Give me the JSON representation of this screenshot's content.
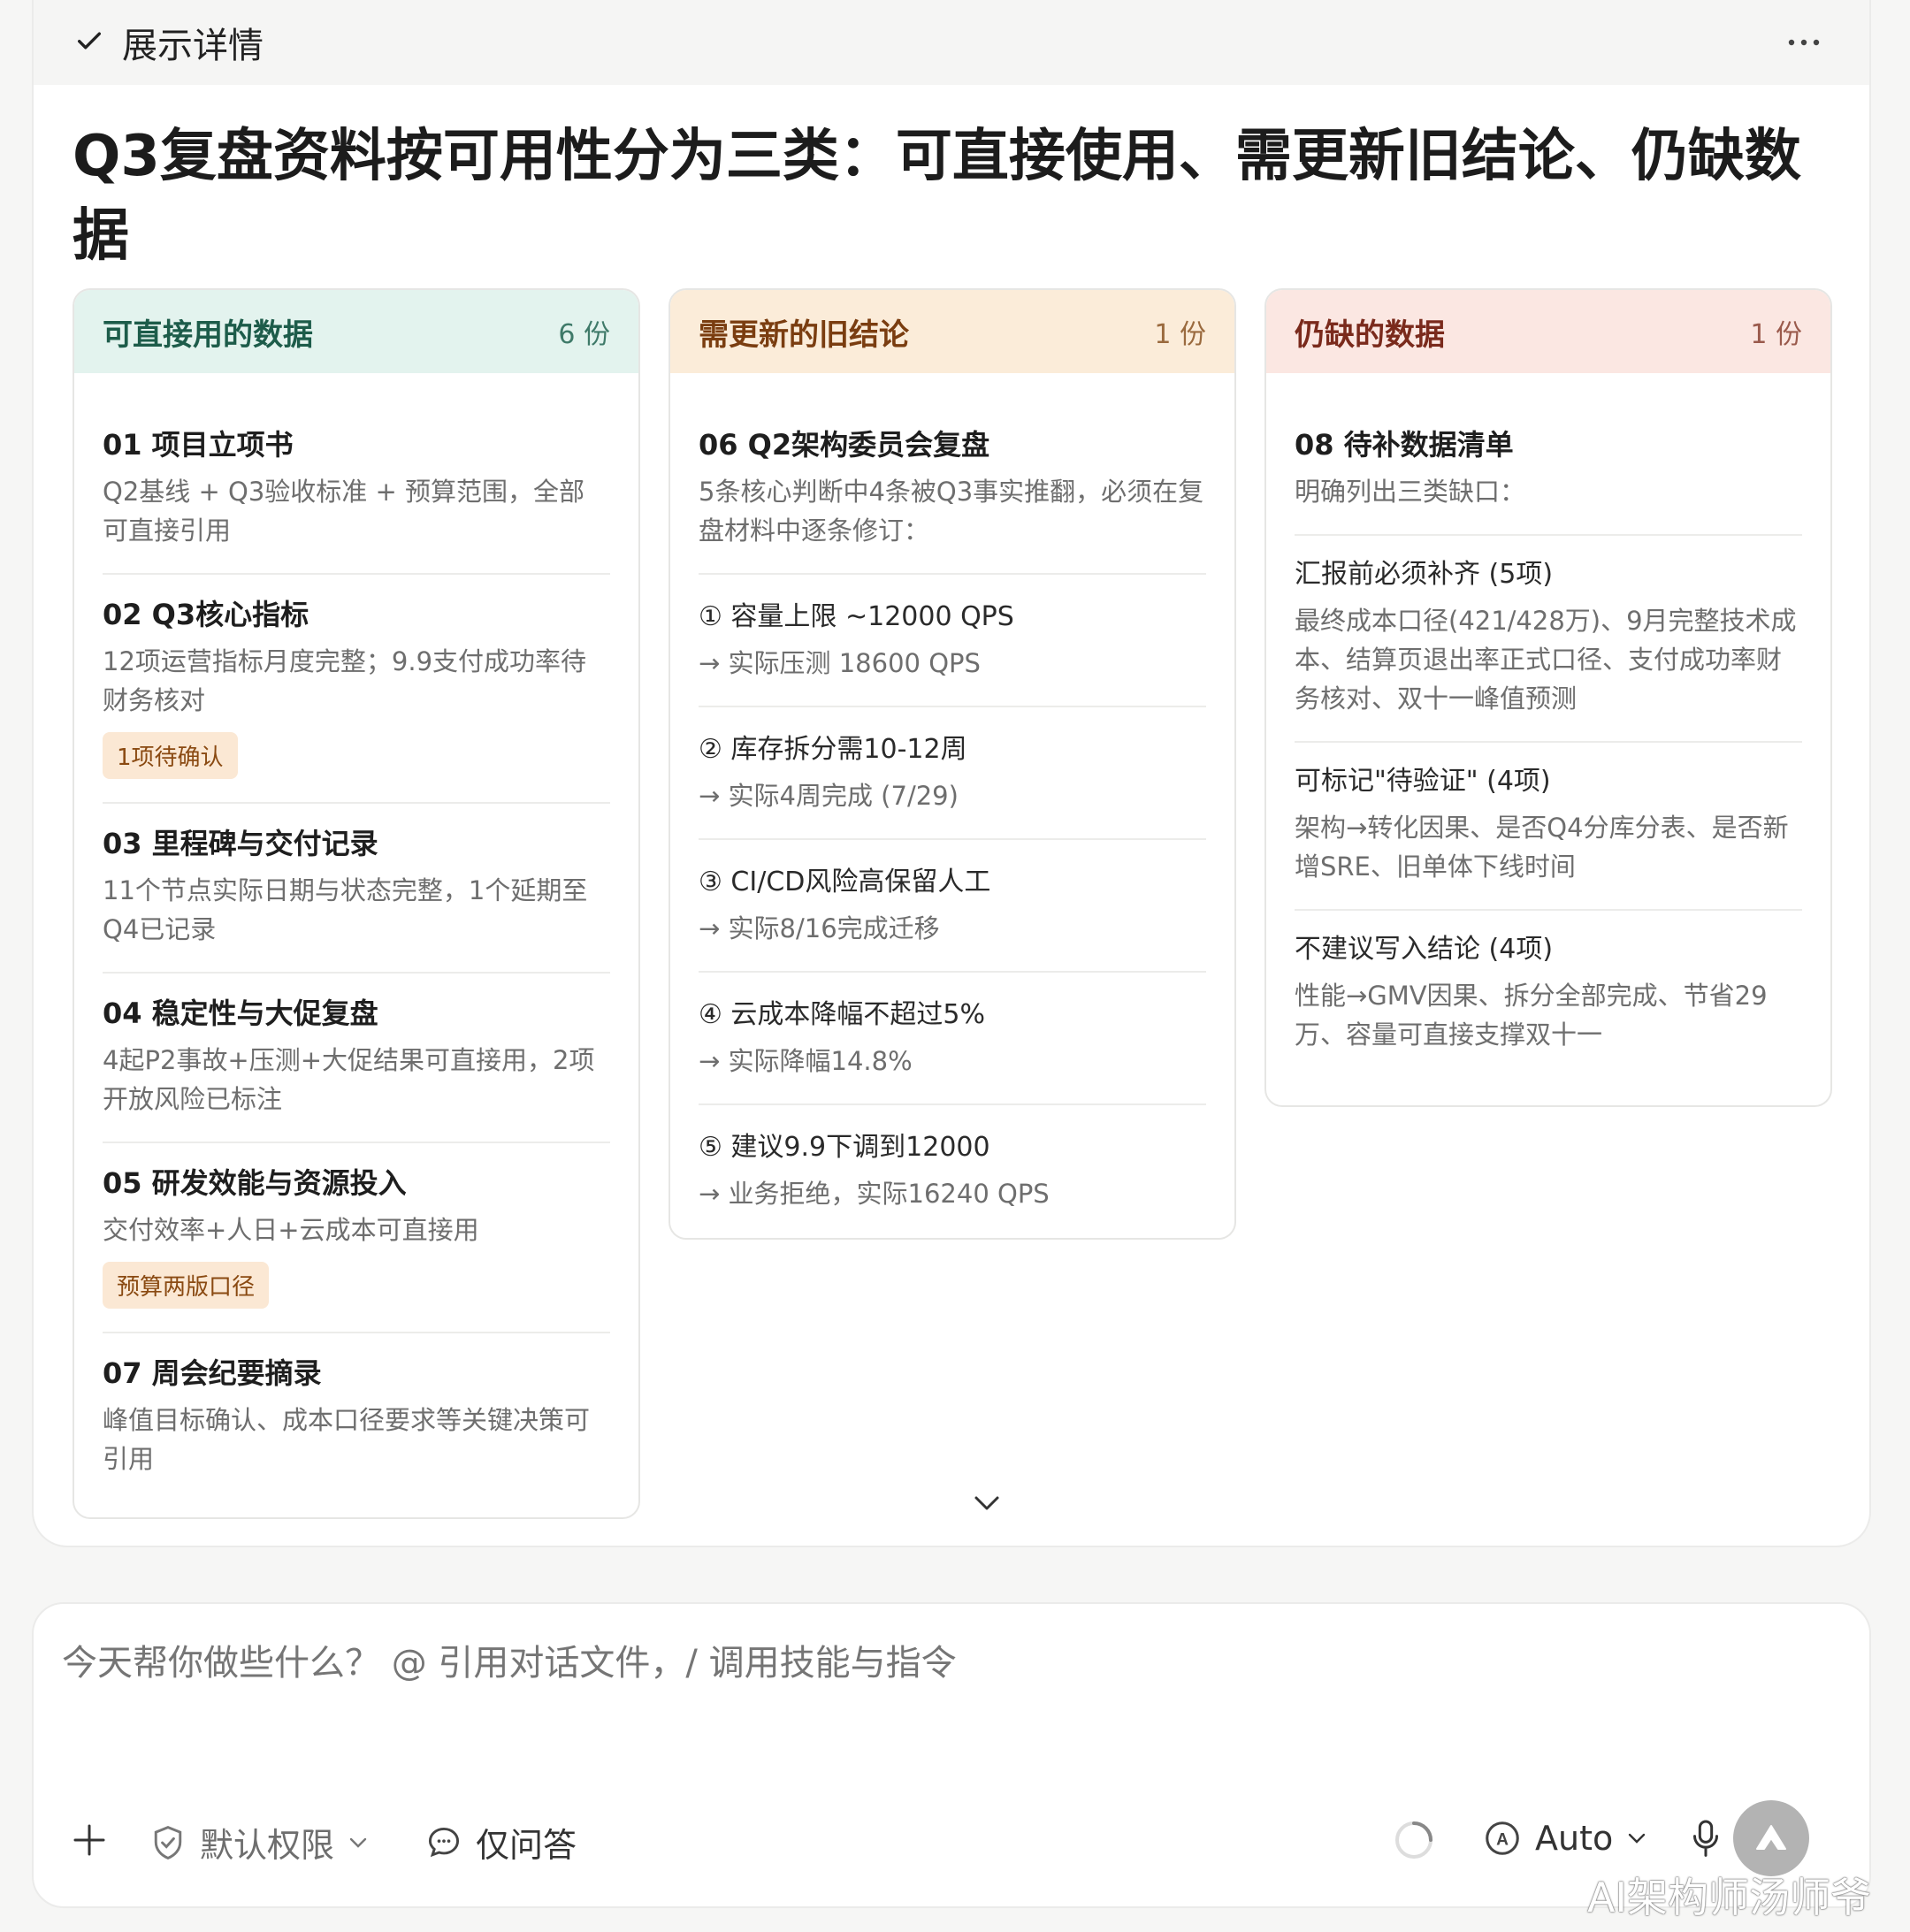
{
  "header": {
    "title": "展示详情",
    "check_icon": "check-icon",
    "more_icon": "more-horizontal-icon"
  },
  "main_title": "Q3复盘资料按可用性分为三类：可直接使用、需更新旧结论、仍缺数据",
  "columns": {
    "usable": {
      "title": "可直接用的数据",
      "count": "6 份",
      "colors": {
        "head_bg": "#e3f3ee",
        "title": "#1d5c4a",
        "count": "#3f7a69"
      },
      "items": [
        {
          "title": "01 项目立项书",
          "desc": "Q2基线 + Q3验收标准 + 预算范围，全部可直接引用",
          "tag": ""
        },
        {
          "title": "02 Q3核心指标",
          "desc": "12项运营指标月度完整；9.9支付成功率待财务核对",
          "tag": "1项待确认"
        },
        {
          "title": "03 里程碑与交付记录",
          "desc": "11个节点实际日期与状态完整，1个延期至Q4已记录",
          "tag": ""
        },
        {
          "title": "04 稳定性与大促复盘",
          "desc": "4起P2事故+压测+大促结果可直接用，2项开放风险已标注",
          "tag": ""
        },
        {
          "title": "05 研发效能与资源投入",
          "desc": "交付效率+人日+云成本可直接用",
          "tag": "预算两版口径"
        },
        {
          "title": "07 周会纪要摘录",
          "desc": "峰值目标确认、成本口径要求等关键决策可引用",
          "tag": ""
        }
      ]
    },
    "update": {
      "title": "需更新的旧结论",
      "count": "1 份",
      "colors": {
        "head_bg": "#fbecd9",
        "title": "#7a3d10",
        "count": "#9a6a3e"
      },
      "doc_title": "06 Q2架构委员会复盘",
      "doc_desc": "5条核心判断中4条被Q3事实推翻，必须在复盘材料中逐条修订：",
      "corrections": [
        {
          "claim": "① 容量上限 ~12000 QPS",
          "fact": "→ 实际压测 18600 QPS"
        },
        {
          "claim": "② 库存拆分需10-12周",
          "fact": "→ 实际4周完成 (7/29)"
        },
        {
          "claim": "③ CI/CD风险高保留人工",
          "fact": "→ 实际8/16完成迁移"
        },
        {
          "claim": "④ 云成本降幅不超过5%",
          "fact": "→ 实际降幅14.8%"
        },
        {
          "claim": "⑤ 建议9.9下调到12000",
          "fact": "→ 业务拒绝，实际16240 QPS"
        }
      ]
    },
    "missing": {
      "title": "仍缺的数据",
      "count": "1 份",
      "colors": {
        "head_bg": "#fbe7e2",
        "title": "#7a2a1c",
        "count": "#9a5a4c"
      },
      "doc_title": "08 待补数据清单",
      "doc_desc": "明确列出三类缺口：",
      "groups": [
        {
          "title": "汇报前必须补齐 (5项)",
          "desc": "最终成本口径(421/428万)、9月完整技术成本、结算页退出率正式口径、支付成功率财务核对、双十一峰值预测"
        },
        {
          "title": "可标记\"待验证\" (4项)",
          "desc": "架构→转化因果、是否Q4分库分表、是否新增SRE、旧单体下线时间"
        },
        {
          "title": "不建议写入结论 (4项)",
          "desc": "性能→GMV因果、拆分全部完成、节省29万、容量可直接支撑双十一"
        }
      ]
    }
  },
  "composer": {
    "placeholder": "今天帮你做些什么？ @ 引用对话文件，/ 调用技能与指令",
    "permission_label": "默认权限",
    "qa_label": "仅问答",
    "model_label": "Auto"
  },
  "watermark": "AI架构师汤师爷"
}
